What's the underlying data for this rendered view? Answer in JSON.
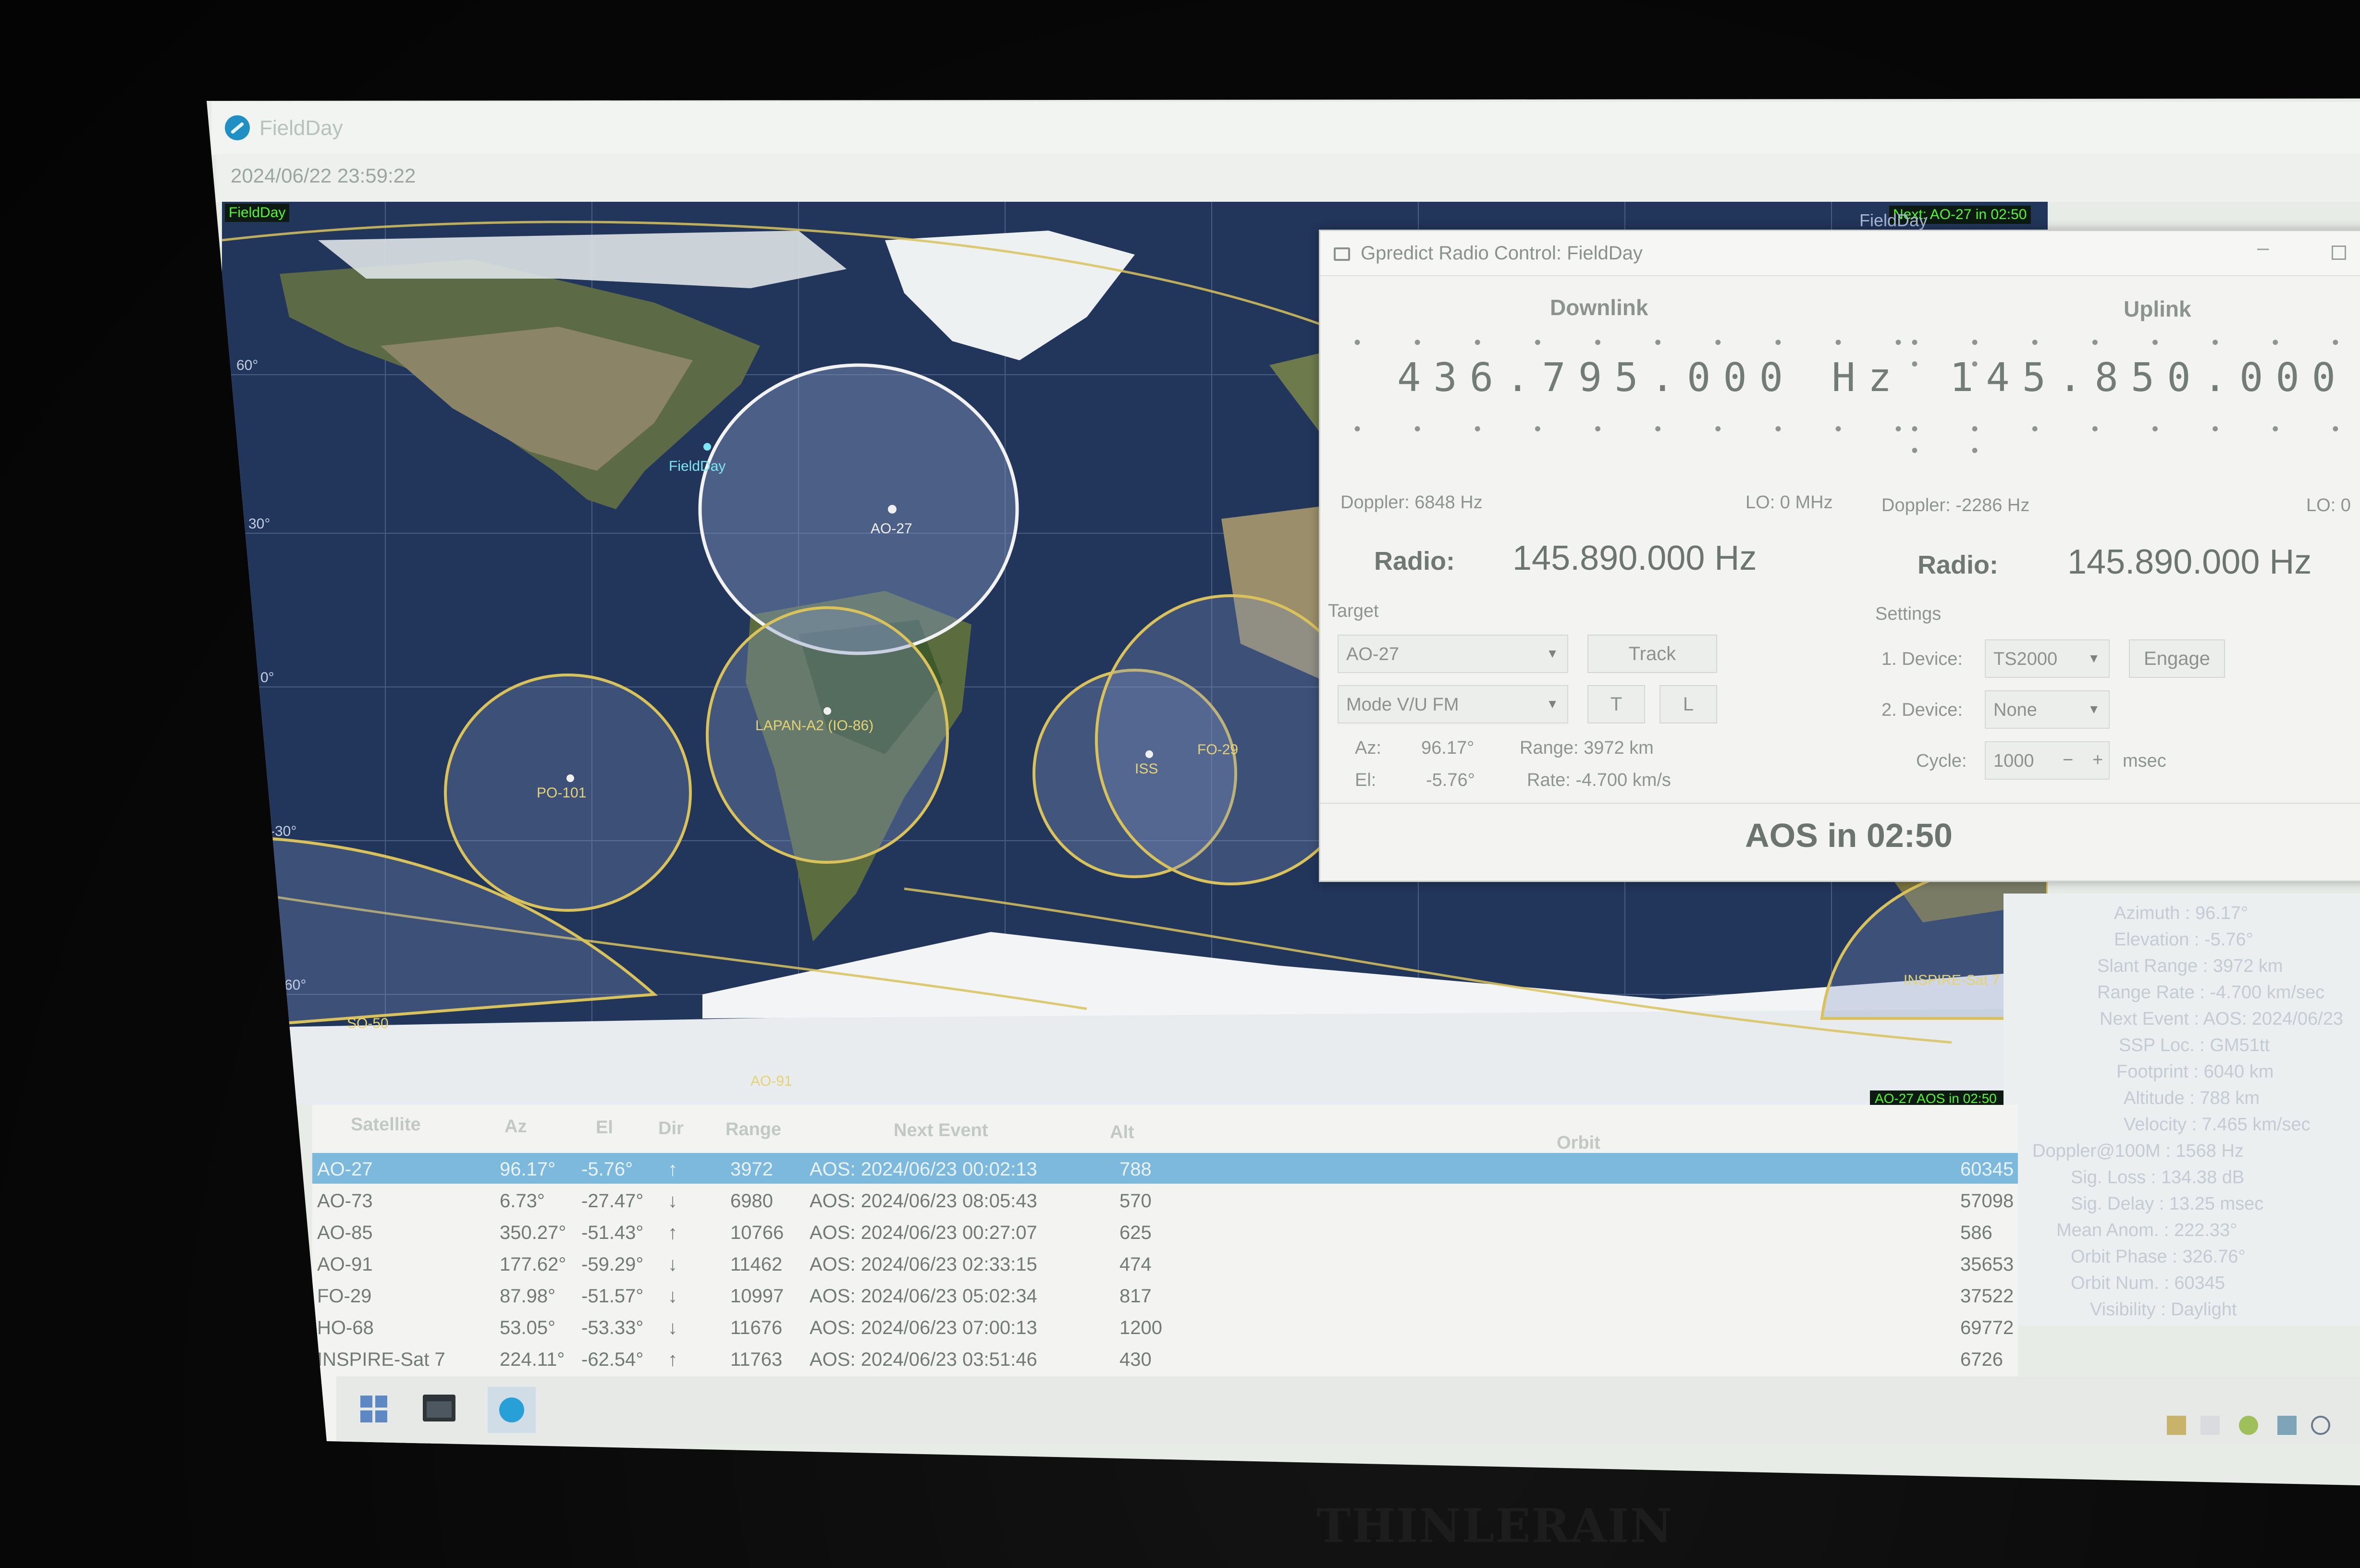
{
  "window": {
    "title": "FieldDay",
    "clock": "2024/06/22 23:59:22",
    "qth_tag": "FieldDay",
    "next_event_tag": "Next: AO-27 in 02:50",
    "tab_label": "FieldDay"
  },
  "map": {
    "ground_station": "FieldDay",
    "lat_labels": [
      "60°",
      "30°",
      "0°",
      "-30°",
      "-60°"
    ],
    "footprints": [
      "AO-27",
      "LAPAN-A2 (IO-86)",
      "PO-101",
      "ISS",
      "FO-29",
      "SO-50",
      "AO-91",
      "INSPIRE-Sat 7"
    ],
    "footprint_label": "AO-27 AOS in 02:50"
  },
  "radio_control": {
    "title": "Gpredict Radio Control: FieldDay",
    "downlink": {
      "heading": "Downlink",
      "frequency": "436.795.000 Hz",
      "doppler": "Doppler: 6848 Hz",
      "lo": "LO: 0 MHz",
      "radio_label": "Radio:",
      "radio_value": "145.890.000 Hz"
    },
    "uplink": {
      "heading": "Uplink",
      "frequency": "145.850.000",
      "doppler": "Doppler: -2286 Hz",
      "lo": "LO: 0",
      "radio_label": "Radio:",
      "radio_value": "145.890.000 Hz"
    },
    "target": {
      "heading": "Target",
      "satellite": "AO-27",
      "mode": "Mode V/U FM",
      "track_button": "Track",
      "t_button": "T",
      "l_button": "L",
      "az_label": "Az:",
      "az_value": "96.17°",
      "el_label": "El:",
      "el_value": "-5.76°",
      "range": "Range: 3972 km",
      "rate": "Rate: -4.700 km/s"
    },
    "settings": {
      "heading": "Settings",
      "device1_label": "1. Device:",
      "device1": "TS2000",
      "engage_button": "Engage",
      "device2_label": "2. Device:",
      "device2": "None",
      "cycle_label": "Cycle:",
      "cycle_value": "1000",
      "minus": "−",
      "plus": "+",
      "unit": "msec"
    },
    "aos_banner": "AOS in 02:50"
  },
  "details": [
    "Azimuth : 96.17°",
    "Elevation : -5.76°",
    "Slant Range : 3972 km",
    "Range Rate : -4.700 km/sec",
    "Next Event : AOS: 2024/06/23",
    "SSP Loc. : GM51tt",
    "Footprint : 6040 km",
    "Altitude : 788 km",
    "Velocity : 7.465 km/sec",
    "Doppler@100M : 1568 Hz",
    "Sig. Loss : 134.38 dB",
    "Sig. Delay : 13.25 msec",
    "Mean Anom. : 222.33°",
    "Orbit Phase : 326.76°",
    "Orbit Num. : 60345",
    "Visibility : Daylight"
  ],
  "table": {
    "headers": [
      "Satellite",
      "Az",
      "El",
      "Dir",
      "Range",
      "Next Event",
      "Alt",
      "Orbit"
    ],
    "rows": [
      {
        "sat": "AO-27",
        "az": "96.17°",
        "el": "-5.76°",
        "dir": "↑",
        "range": "3972",
        "next": "AOS: 2024/06/23 00:02:13",
        "alt": "788",
        "orbit": "60345"
      },
      {
        "sat": "AO-73",
        "az": "6.73°",
        "el": "-27.47°",
        "dir": "↓",
        "range": "6980",
        "next": "AOS: 2024/06/23 08:05:43",
        "alt": "570",
        "orbit": "57098"
      },
      {
        "sat": "AO-85",
        "az": "350.27°",
        "el": "-51.43°",
        "dir": "↑",
        "range": "10766",
        "next": "AOS: 2024/06/23 00:27:07",
        "alt": "625",
        "orbit": "586"
      },
      {
        "sat": "AO-91",
        "az": "177.62°",
        "el": "-59.29°",
        "dir": "↓",
        "range": "11462",
        "next": "AOS: 2024/06/23 02:33:15",
        "alt": "474",
        "orbit": "35653"
      },
      {
        "sat": "FO-29",
        "az": "87.98°",
        "el": "-51.57°",
        "dir": "↓",
        "range": "10997",
        "next": "AOS: 2024/06/23 05:02:34",
        "alt": "817",
        "orbit": "37522"
      },
      {
        "sat": "HO-68",
        "az": "53.05°",
        "el": "-53.33°",
        "dir": "↓",
        "range": "11676",
        "next": "AOS: 2024/06/23 07:00:13",
        "alt": "1200",
        "orbit": "69772"
      },
      {
        "sat": "INSPIRE-Sat 7",
        "az": "224.11°",
        "el": "-62.54°",
        "dir": "↑",
        "range": "11763",
        "next": "AOS: 2024/06/23 03:51:46",
        "alt": "430",
        "orbit": "6726"
      }
    ]
  },
  "monitor_brand": "THINLERAIN",
  "colors": {
    "ocean": "#22355a",
    "footprint": "#d9c25a",
    "selected_row": "#7cb9dd",
    "status_green": "#53f533"
  }
}
